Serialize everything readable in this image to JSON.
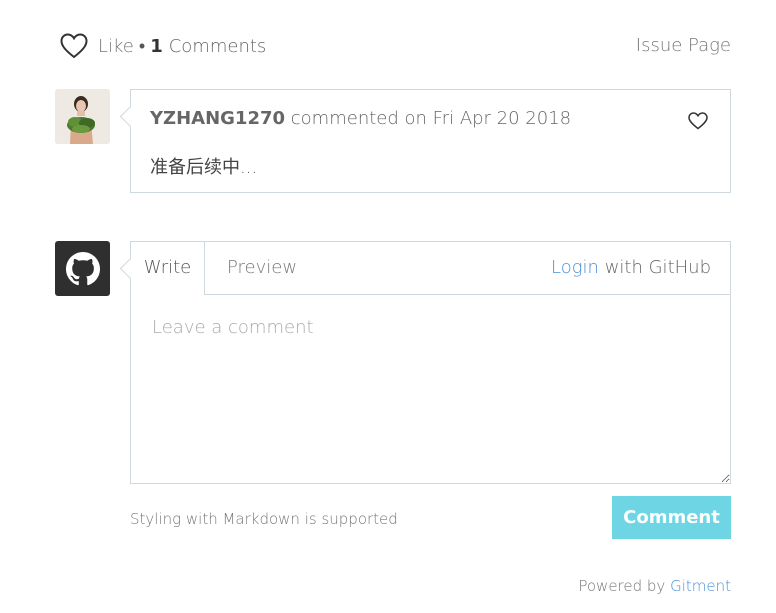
{
  "header": {
    "like_label": "Like",
    "separator": "•",
    "comment_count": "1",
    "comments_label": "Comments",
    "issue_link": "Issue Page"
  },
  "comment": {
    "author": "YZHANG1270",
    "meta": "commented on Fri Apr 20 2018",
    "body": "准备后续中..."
  },
  "editor": {
    "tabs": [
      {
        "label": "Write",
        "active": true
      },
      {
        "label": "Preview",
        "active": false
      }
    ],
    "login_link": "Login",
    "login_suffix": "with GitHub",
    "placeholder": "Leave a comment"
  },
  "footer": {
    "tip": "Styling with Markdown is supported",
    "comment_button": "Comment",
    "powered_by": "Powered by",
    "powered_link": "Gitment"
  },
  "icons": {
    "like": "heart-outline-icon",
    "comment_like": "heart-outline-icon",
    "github": "github-octocat-icon"
  },
  "colors": {
    "accent": "#6dd5e3",
    "link": "#4a8fd6",
    "border": "#cfd8dc",
    "github_bg": "#2f2f2f"
  }
}
